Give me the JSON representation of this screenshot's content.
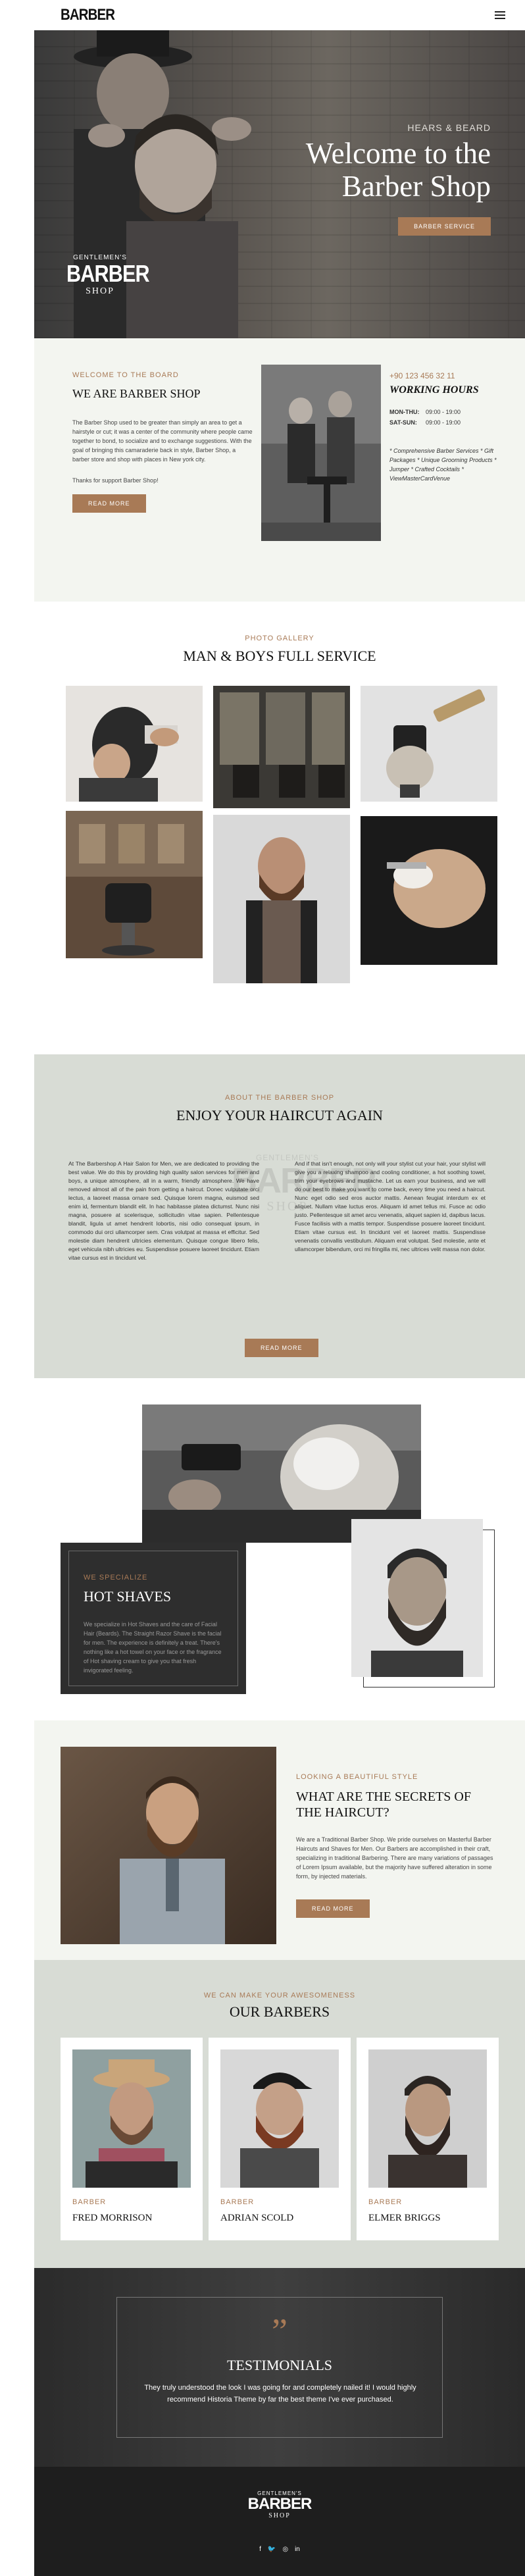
{
  "header": {
    "logo": "BARBER"
  },
  "hero": {
    "subtitle": "HEARS & BEARD",
    "title_line1": "Welcome to the",
    "title_line2": "Barber Shop",
    "button": "BARBER SERVICE",
    "badge_top": "GENTLEMEN'S",
    "badge_main": "BARBER",
    "badge_bottom": "SHOP"
  },
  "about": {
    "eyebrow": "WELCOME TO THE BOARD",
    "title": "WE ARE BARBER SHOP",
    "text": "The Barber Shop used to be greater than simply an area to get a hairstyle or cut; it was a center of the community where people came together to bond, to socialize and to exchange suggestions. With the goal of bringing this camaraderie back in style, Barber Shop, a barber store and shop with places in New york city.",
    "thanks": "Thanks for support Barber Shop!",
    "button": "READ MORE",
    "phone": "+90 123 456 32 11",
    "hours_title": "WORKING HOURS",
    "hours": [
      {
        "days": "MON-THU:",
        "time": "09:00 - 19:00"
      },
      {
        "days": "SAT-SUN:",
        "time": "09:00 - 19:00"
      }
    ],
    "services": "* Comprehensive Barber Services * Gift Packages * Unique Grooming Products * Jumper * Crafted Cocktails * ViewMasterCardVenue"
  },
  "gallery": {
    "eyebrow": "PHOTO GALLERY",
    "title": "MAN & BOYS FULL SERVICE"
  },
  "about2": {
    "eyebrow": "ABOUT THE BARBER SHOP",
    "title": "ENJOY YOUR HAIRCUT AGAIN",
    "col1": "At The Barbershop A Hair Salon for Men, we are dedicated to providing the best value. We do this by providing high quality salon services for men and boys, a unique atmosphere, all in a warm, friendly atmosphere. We have removed almost all of the pain from getting a haircut. Donec vulputate orci lectus, a laoreet massa ornare sed. Quisque lorem magna, euismod sed enim id, fermentum blandit elit. In hac habitasse platea dictumst. Nunc nisi magna, posuere at scelerisque, sollicitudin vitae sapien. Pellentesque blandit, ligula ut amet hendrerit lobortis, nisi odio consequat ipsum, in commodo dui orci ullamcorper sem. Cras volutpat at massa et efficitur. Sed molestie diam hendrerit ultricies elementum. Quisque congue libero felis, eget vehicula nibh ultricies eu. Suspendisse posuere laoreet tincidunt. Etiam vitae cursus est in tincidunt vel.",
    "col2": "And if that isn't enough, not only will your stylist cut your hair, your stylist will give you a relaxing shampoo and cooling conditioner, a hot soothing towel, trim your eyebrows and mustache. Let us earn your business, and we will do our best to make you want to come back, every time you need a haircut. Nunc eget odio sed eros auctor mattis. Aenean feugiat interdum ex et aliquet. Nullam vitae luctus eros. Aliquam id amet tellus mi. Fusce ac odio justo. Pellentesque sit amet arcu venenatis, aliquet sapien id, dapibus lacus. Fusce facilisis with a mattis tempor. Suspendisse posuere laoreet tincidunt. Etiam vitae cursus est. In tincidunt vel et laoreet mattis. Suspendisse venenatis convallis vestibulum. Aliquam erat volutpat. Sed molestie, ante et ullamcorper bibendum, orci mi fringilla mi, nec ultrices velit massa non dolor.",
    "button": "READ MORE",
    "watermark_top": "GENTLEMEN'S",
    "watermark_main": "BARBER",
    "watermark_bottom": "SHOP"
  },
  "shaves": {
    "eyebrow": "WE SPECIALIZE",
    "title": "HOT SHAVES",
    "text": "We specialize in Hot Shaves and the care of Facial Hair (Beards). The Straight Razor Shave is the facial for men. The experience is definitely a treat. There's nothing like a hot towel on your face or the fragrance of Hot shaving cream to give you that fresh invigorated feeling."
  },
  "secrets": {
    "eyebrow": "LOOKING A BEAUTIFUL STYLE",
    "title": "WHAT ARE THE SECRETS OF THE HAIRCUT?",
    "text": "We are a Traditional Barber Shop. We pride ourselves on Masterful Barber Haircuts and Shaves for Men. Our Barbers are accomplished in their craft, specializing in traditional Barbering. There are many variations of passages of Lorem Ipsum available, but the majority have suffered alteration in some form, by injected materials.",
    "button": "READ MORE"
  },
  "barbers": {
    "eyebrow": "WE CAN MAKE YOUR AWESOMENESS",
    "title": "OUR BARBERS",
    "items": [
      {
        "role": "BARBER",
        "name": "FRED MORRISON"
      },
      {
        "role": "BARBER",
        "name": "ADRIAN SCOLD"
      },
      {
        "role": "BARBER",
        "name": "ELMER BRIGGS"
      }
    ]
  },
  "testimonials": {
    "title": "TESTIMONIALS",
    "quote": "They truly understood the look I was going for and completely nailed it! I would highly recommend Historia Theme by far the best theme I've ever purchased."
  },
  "footer": {
    "badge_top": "GENTLEMEN'S",
    "badge_main": "BARBER",
    "badge_bottom": "SHOP",
    "social": [
      "f",
      "🐦",
      "◎",
      "in"
    ]
  },
  "colors": {
    "accent": "#a87a56",
    "light_bg": "#f3f5f0",
    "sage_bg": "#d8dcd5",
    "dark": "#2e2e2e"
  },
  "icons": [
    "menu-icon",
    "facebook-icon",
    "twitter-icon",
    "instagram-icon",
    "linkedin-icon",
    "quote-icon"
  ]
}
